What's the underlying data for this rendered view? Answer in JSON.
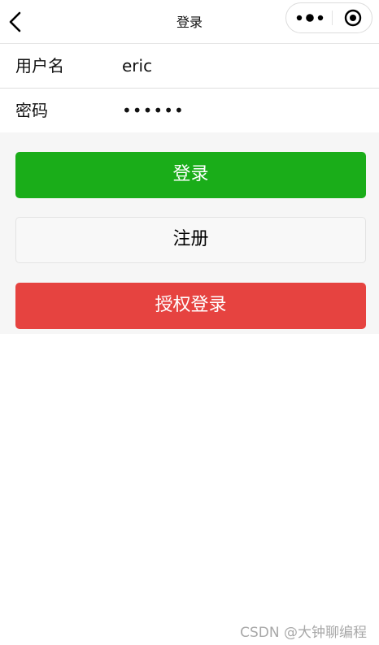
{
  "navbar": {
    "title": "登录",
    "back_icon": "chevron-left-icon",
    "more_icon": "more-dots-icon",
    "close_icon": "target-close-icon"
  },
  "form": {
    "username": {
      "label": "用户名",
      "value": "eric"
    },
    "password": {
      "label": "密码",
      "value": "••••••"
    }
  },
  "buttons": {
    "login": "登录",
    "register": "注册",
    "authorize_login": "授权登录"
  },
  "colors": {
    "login_green": "#1aad19",
    "auth_red": "#e64340",
    "register_bg": "#f8f8f8",
    "area_bg": "#f6f6f6"
  },
  "watermark": "CSDN @大钟聊编程"
}
